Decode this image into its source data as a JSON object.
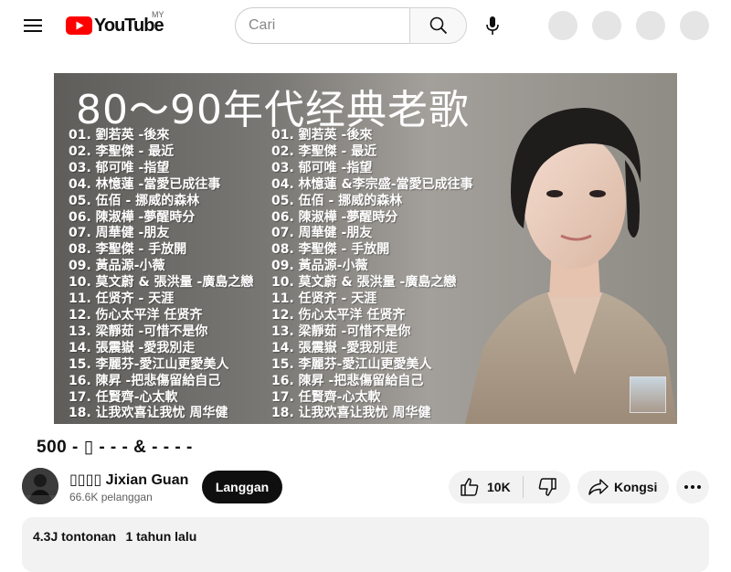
{
  "header": {
    "logo_text": "YouTube",
    "region": "MY",
    "search_placeholder": "Cari",
    "icons": [
      "menu-icon",
      "youtube-logo-icon",
      "search-icon",
      "mic-icon"
    ]
  },
  "thumbnail": {
    "title": "80～90年代经典老歌",
    "songs_left": [
      "01. 劉若英 -後來",
      "02. 李聖傑 - 最近",
      "03. 郁可唯 -指望",
      "04. 林憶蓮 -當愛已成往事",
      "05. 伍佰 - 挪威的森林",
      "06. 陳淑樺 -夢醒時分",
      "07. 周華健 -朋友",
      "08. 李聖傑 - 手放開",
      "09. 黃品源-小薇",
      "10. 莫文蔚 & 張洪量 -廣島之戀",
      "11. 任贤齐 - 天涯",
      "12. 伤心太平洋 任贤齐",
      "13. 梁靜茹 -可惜不是你",
      "14. 張震嶽 -愛我別走",
      "15. 李麗芬-愛江山更愛美人",
      "16. 陳昇 -把悲傷留給自己",
      "17. 任賢齊-心太軟",
      "18. 让我欢喜让我忧 周华健"
    ],
    "songs_right": [
      "01. 劉若英 -後來",
      "02. 李聖傑 - 最近",
      "03. 郁可唯 -指望",
      "04. 林憶蓮 &李宗盛-當愛已成往事",
      "05. 伍佰 - 挪威的森林",
      "06. 陳淑樺 -夢醒時分",
      "07. 周華健 -朋友",
      "08. 李聖傑 - 手放開",
      "09. 黃品源-小薇",
      "10. 莫文蔚 & 張洪量 -廣島之戀",
      "11. 任贤齐 - 天涯",
      "12. 伤心太平洋 任贤齐",
      "13. 梁靜茹 -可惜不是你",
      "14. 張震嶽 -愛我別走",
      "15. 李麗芬-愛江山更愛美人",
      "16. 陳昇 -把悲傷留給自己",
      "17. 任賢齊-心太軟",
      "18. 让我欢喜让我忧 周华健"
    ]
  },
  "video": {
    "title": "500 -         ▯  -     -     -     & -       -        -      -"
  },
  "channel": {
    "name": "▯▯▯▯ Jixian Guan",
    "subscribers": "66.6K pelanggan",
    "subscribe_label": "Langgan"
  },
  "actions": {
    "like_count": "10K",
    "share_label": "Kongsi"
  },
  "description": {
    "views": "4.3J tontonan",
    "date": "1 tahun lalu"
  },
  "colors": {
    "brand_red": "#ff0000",
    "chip_bg": "#f2f2f2",
    "subscribe_bg": "#0f0f0f"
  }
}
